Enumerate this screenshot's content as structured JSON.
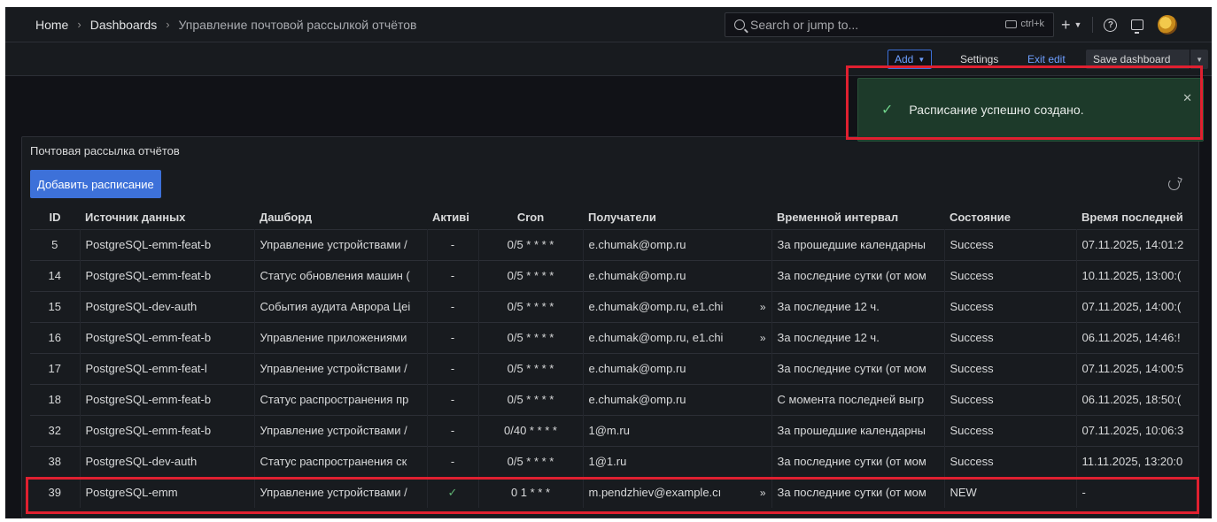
{
  "breadcrumb": {
    "home": "Home",
    "dashboards": "Dashboards",
    "current": "Управление почтовой рассылкой отчётов"
  },
  "search": {
    "placeholder": "Search or jump to...",
    "shortcut": "ctrl+k"
  },
  "topbar": {
    "plus": "+"
  },
  "toolbar": {
    "add": "Add",
    "settings": "Settings",
    "exit_edit": "Exit edit",
    "save_dashboard": "Save dashboard"
  },
  "toast": {
    "message": "Расписание успешно создано.",
    "status_color": "#6fd28a"
  },
  "panel": {
    "title": "Почтовая рассылка отчётов",
    "add_button": "Добавить расписание"
  },
  "table": {
    "columns": [
      "ID",
      "Источник данных",
      "Дашборд",
      "Активі",
      "Cron",
      "Получатели",
      "Временной интервал",
      "Состояние",
      "Время последней"
    ],
    "rows": [
      {
        "id": "5",
        "source": "PostgreSQL-emm-feat-b",
        "dashboard": "Управление устройствами /",
        "active": "-",
        "cron": "0/5 * * * *",
        "recipients": "e.chumak@omp.ru",
        "more": "",
        "interval": "За прошедшие календарны",
        "state": "Success",
        "last_time": "07.11.2025, 14:01:2"
      },
      {
        "id": "14",
        "source": "PostgreSQL-emm-feat-b",
        "dashboard": "Статус обновления машин (",
        "active": "-",
        "cron": "0/5 * * * *",
        "recipients": "e.chumak@omp.ru",
        "more": "",
        "interval": "За последние сутки (от мом",
        "state": "Success",
        "last_time": "10.11.2025, 13:00:("
      },
      {
        "id": "15",
        "source": "PostgreSQL-dev-auth",
        "dashboard": "События аудита Аврора Цеі",
        "active": "-",
        "cron": "0/5 * * * *",
        "recipients": "e.chumak@omp.ru, e1.chi",
        "more": "»",
        "interval": "За последние 12 ч.",
        "state": "Success",
        "last_time": "07.11.2025, 14:00:("
      },
      {
        "id": "16",
        "source": "PostgreSQL-emm-feat-b",
        "dashboard": "Управление приложениями",
        "active": "-",
        "cron": "0/5 * * * *",
        "recipients": "e.chumak@omp.ru, e1.chi",
        "more": "»",
        "interval": "За последние 12 ч.",
        "state": "Success",
        "last_time": "06.11.2025, 14:46:!"
      },
      {
        "id": "17",
        "source": "PostgreSQL-emm-feat-l",
        "dashboard": "Управление устройствами /",
        "active": "-",
        "cron": "0/5 * * * *",
        "recipients": "e.chumak@omp.ru",
        "more": "",
        "interval": "За последние сутки (от мом",
        "state": "Success",
        "last_time": "07.11.2025, 14:00:5"
      },
      {
        "id": "18",
        "source": "PostgreSQL-emm-feat-b",
        "dashboard": "Статус распространения пр",
        "active": "-",
        "cron": "0/5 * * * *",
        "recipients": "e.chumak@omp.ru",
        "more": "",
        "interval": "С момента последней выгр",
        "state": "Success",
        "last_time": "06.11.2025, 18:50:("
      },
      {
        "id": "32",
        "source": "PostgreSQL-emm-feat-b",
        "dashboard": "Управление устройствами /",
        "active": "-",
        "cron": "0/40 * * * *",
        "recipients": "1@m.ru",
        "more": "",
        "interval": "За прошедшие календарны",
        "state": "Success",
        "last_time": "07.11.2025, 10:06:3"
      },
      {
        "id": "38",
        "source": "PostgreSQL-dev-auth",
        "dashboard": "Статус распространения ск",
        "active": "-",
        "cron": "0/5 * * * *",
        "recipients": "1@1.ru",
        "more": "",
        "interval": "За последние сутки (от мом",
        "state": "Success",
        "last_time": "11.11.2025, 13:20:0"
      },
      {
        "id": "39",
        "source": "PostgreSQL-emm",
        "dashboard": "Управление устройствами /",
        "active": "✓",
        "cron": "0 1 * * *",
        "recipients": "m.pendzhiev@example.cı",
        "more": "»",
        "interval": "За последние сутки (от мом",
        "state": "NEW",
        "last_time": "-"
      }
    ]
  },
  "colors": {
    "background": "#111217",
    "panel": "#181b1f",
    "primary": "#3d71d9",
    "highlight": "#e02030",
    "toast": "#1d3a2a"
  }
}
